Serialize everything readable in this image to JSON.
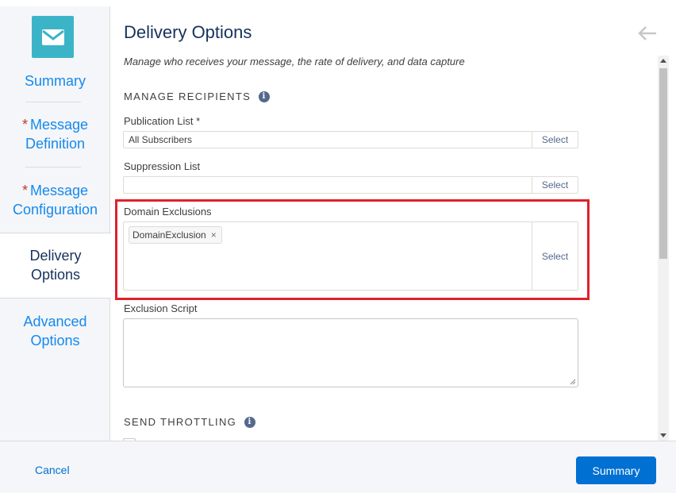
{
  "sidebar": {
    "items": [
      {
        "label": "Summary",
        "required": false,
        "active": false
      },
      {
        "label": "Message Definition",
        "required": true,
        "active": false
      },
      {
        "label": "Message Configuration",
        "required": true,
        "active": false
      },
      {
        "label": "Delivery Options",
        "required": false,
        "active": true
      },
      {
        "label": "Advanced Options",
        "required": false,
        "active": false
      }
    ],
    "required_marker": "*"
  },
  "main": {
    "title": "Delivery Options",
    "subtitle": "Manage who receives your message, the rate of delivery, and data capture",
    "manage_recipients": {
      "heading": "MANAGE RECIPIENTS",
      "publication_list": {
        "label": "Publication List",
        "required_marker": "*",
        "value": "All Subscribers",
        "select_label": "Select"
      },
      "suppression_list": {
        "label": "Suppression List",
        "value": "",
        "select_label": "Select"
      },
      "domain_exclusions": {
        "label": "Domain Exclusions",
        "pills": [
          "DomainExclusion"
        ],
        "pill_remove": "×",
        "select_label": "Select"
      },
      "exclusion_script": {
        "label": "Exclusion Script",
        "value": ""
      }
    },
    "send_throttling": {
      "heading": "SEND THROTTLING"
    }
  },
  "footer": {
    "cancel_label": "Cancel",
    "summary_label": "Summary"
  },
  "colors": {
    "accent": "#0070d2",
    "link": "#1589ee",
    "highlight": "#e0212b",
    "logo_bg": "#3cb4c8"
  },
  "icons": {
    "logo": "envelope-icon",
    "back": "arrow-left-icon",
    "info": "info-icon"
  }
}
